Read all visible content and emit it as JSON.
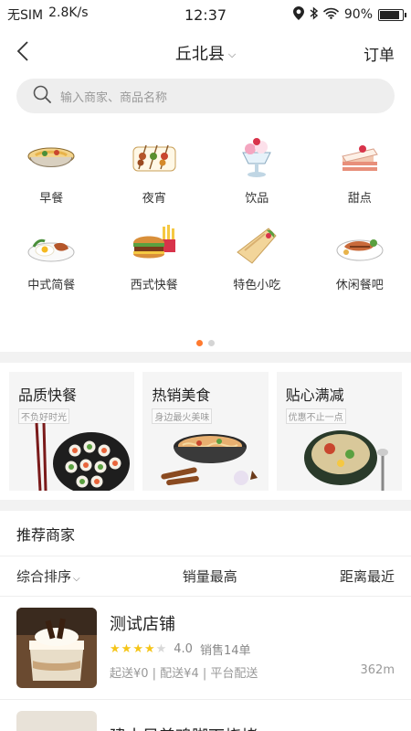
{
  "status_bar": {
    "carrier": "无SIM",
    "speed": "2.8K/s",
    "time": "12:37",
    "battery": "90%",
    "battery_level": 0.9
  },
  "header": {
    "location": "丘北县",
    "order_label": "订单"
  },
  "search": {
    "placeholder": "输入商家、商品名称"
  },
  "categories": [
    {
      "label": "早餐",
      "icon": "noodle-bowl-icon"
    },
    {
      "label": "夜宵",
      "icon": "skewers-icon"
    },
    {
      "label": "饮品",
      "icon": "ice-cream-sundae-icon"
    },
    {
      "label": "甜点",
      "icon": "cake-slice-icon"
    },
    {
      "label": "中式简餐",
      "icon": "fried-egg-plate-icon"
    },
    {
      "label": "西式快餐",
      "icon": "burger-fries-icon"
    },
    {
      "label": "特色小吃",
      "icon": "wrap-icon"
    },
    {
      "label": "休闲餐吧",
      "icon": "steak-plate-icon"
    }
  ],
  "carousel": {
    "pages": 2,
    "active_page": 1
  },
  "promos": [
    {
      "title": "品质快餐",
      "subtitle": "不负好时光",
      "icon": "sushi-platter-icon"
    },
    {
      "title": "热销美食",
      "subtitle": "身边最火美味",
      "icon": "noodle-bowl-icon"
    },
    {
      "title": "贴心满减",
      "subtitle": "优惠不止一点",
      "icon": "soup-bowl-icon"
    }
  ],
  "recommend": {
    "title": "推荐商家"
  },
  "sort": {
    "default": "综合排序",
    "sales": "销量最高",
    "distance": "距离最近"
  },
  "shops": [
    {
      "name": "测试店铺",
      "rating": "4.0",
      "rating_value": 4,
      "sales": "销售14单",
      "delivery": "起送¥0 | 配送¥4 | 平台配送",
      "distance": "362m"
    },
    {
      "name": "建水风美鸡脚下烧烤"
    }
  ],
  "colors": {
    "accent": "#ff7a2f",
    "star": "#f5c518",
    "star_empty": "#d8d8d8"
  }
}
